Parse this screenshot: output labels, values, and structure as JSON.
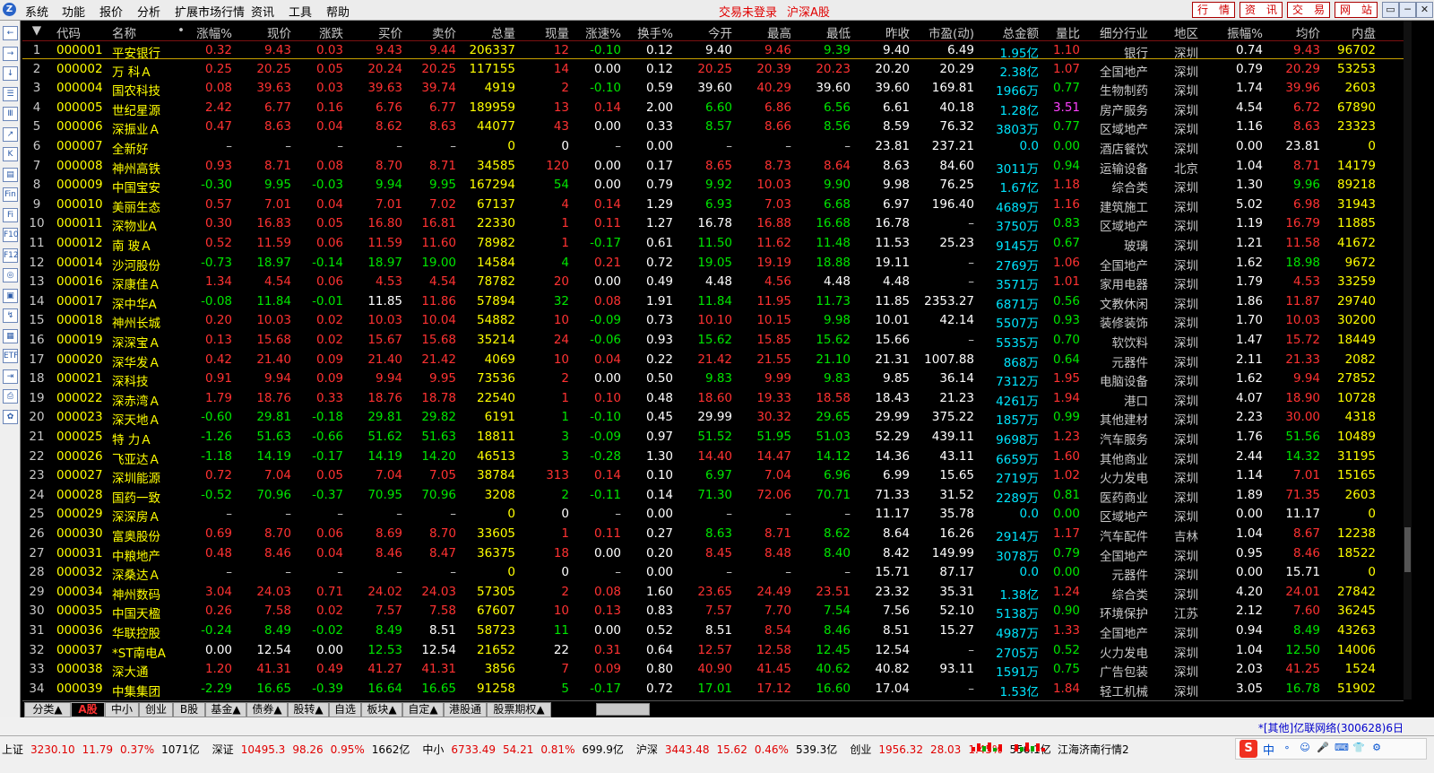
{
  "menubar": {
    "logo": "Z",
    "menus": [
      "系统",
      "功能",
      "报价",
      "分析",
      "扩展市场行情",
      "资讯",
      "工具",
      "帮助"
    ],
    "trade_status": "交易未登录",
    "market_title": "沪深A股",
    "right_buttons": [
      "行　情",
      "资　讯",
      "交　易",
      "网　站"
    ],
    "window_buttons": [
      "▭",
      "─",
      "✕"
    ]
  },
  "left_toolbar": [
    "←",
    "→",
    "↓",
    "☰",
    "Ⅲ",
    "↗",
    "K",
    "▤",
    "Fin",
    "Fi",
    "F10",
    "F12",
    "◎",
    "▣",
    "↯",
    "▦",
    "ETF",
    "⇥",
    "⎙",
    "✿"
  ],
  "table": {
    "headers": [
      "",
      "代码",
      "名称",
      "•",
      "涨幅%",
      "现价",
      "涨跌",
      "买价",
      "卖价",
      "总量",
      "现量",
      "涨速%",
      "换手%",
      "今开",
      "最高",
      "最低",
      "昨收",
      "市盈(动)",
      "总金额",
      "量比",
      "细分行业",
      "地区",
      "振幅%",
      "均价",
      "内盘"
    ],
    "rows": [
      [
        "1",
        "000001",
        "平安银行",
        "0.32",
        "9.43",
        "0.03",
        "9.43",
        "9.44",
        "206337",
        "12",
        "-0.10",
        "0.12",
        "9.40",
        "9.46",
        "9.39",
        "9.40",
        "6.49",
        "1.95亿",
        "1.10",
        "银行",
        "深圳",
        "0.74",
        "9.43",
        "96702"
      ],
      [
        "2",
        "000002",
        "万 科Ａ",
        "0.25",
        "20.25",
        "0.05",
        "20.24",
        "20.25",
        "117155",
        "14",
        "0.00",
        "0.12",
        "20.25",
        "20.39",
        "20.23",
        "20.20",
        "20.29",
        "2.38亿",
        "1.07",
        "全国地产",
        "深圳",
        "0.79",
        "20.29",
        "53253"
      ],
      [
        "3",
        "000004",
        "国农科技",
        "0.08",
        "39.63",
        "0.03",
        "39.63",
        "39.74",
        "4919",
        "2",
        "-0.10",
        "0.59",
        "39.60",
        "40.29",
        "39.60",
        "39.60",
        "169.81",
        "1966万",
        "0.77",
        "生物制药",
        "深圳",
        "1.74",
        "39.96",
        "2603"
      ],
      [
        "4",
        "000005",
        "世纪星源",
        "2.42",
        "6.77",
        "0.16",
        "6.76",
        "6.77",
        "189959",
        "13",
        "0.14",
        "2.00",
        "6.60",
        "6.86",
        "6.56",
        "6.61",
        "40.18",
        "1.28亿",
        "3.51",
        "房产服务",
        "深圳",
        "4.54",
        "6.72",
        "67890"
      ],
      [
        "5",
        "000006",
        "深振业Ａ",
        "0.47",
        "8.63",
        "0.04",
        "8.62",
        "8.63",
        "44077",
        "43",
        "0.00",
        "0.33",
        "8.57",
        "8.66",
        "8.56",
        "8.59",
        "76.32",
        "3803万",
        "0.77",
        "区域地产",
        "深圳",
        "1.16",
        "8.63",
        "23323"
      ],
      [
        "6",
        "000007",
        "全新好",
        "–",
        "–",
        "–",
        "–",
        "–",
        "0",
        "0",
        "–",
        "0.00",
        "–",
        "–",
        "–",
        "23.81",
        "237.21",
        "0.0",
        "0.00",
        "酒店餐饮",
        "深圳",
        "0.00",
        "23.81",
        "0"
      ],
      [
        "7",
        "000008",
        "神州高铁",
        "0.93",
        "8.71",
        "0.08",
        "8.70",
        "8.71",
        "34585",
        "120",
        "0.00",
        "0.17",
        "8.65",
        "8.73",
        "8.64",
        "8.63",
        "84.60",
        "3011万",
        "0.94",
        "运输设备",
        "北京",
        "1.04",
        "8.71",
        "14179"
      ],
      [
        "8",
        "000009",
        "中国宝安",
        "-0.30",
        "9.95",
        "-0.03",
        "9.94",
        "9.95",
        "167294",
        "54",
        "0.00",
        "0.79",
        "9.92",
        "10.03",
        "9.90",
        "9.98",
        "76.25",
        "1.67亿",
        "1.18",
        "综合类",
        "深圳",
        "1.30",
        "9.96",
        "89218"
      ],
      [
        "9",
        "000010",
        "美丽生态",
        "0.57",
        "7.01",
        "0.04",
        "7.01",
        "7.02",
        "67137",
        "4",
        "0.14",
        "1.29",
        "6.93",
        "7.03",
        "6.68",
        "6.97",
        "196.40",
        "4689万",
        "1.16",
        "建筑施工",
        "深圳",
        "5.02",
        "6.98",
        "31943"
      ],
      [
        "10",
        "000011",
        "深物业A",
        "0.30",
        "16.83",
        "0.05",
        "16.80",
        "16.81",
        "22330",
        "1",
        "0.11",
        "1.27",
        "16.78",
        "16.88",
        "16.68",
        "16.78",
        "–",
        "3750万",
        "0.83",
        "区域地产",
        "深圳",
        "1.19",
        "16.79",
        "11885"
      ],
      [
        "11",
        "000012",
        "南 玻Ａ",
        "0.52",
        "11.59",
        "0.06",
        "11.59",
        "11.60",
        "78982",
        "1",
        "-0.17",
        "0.61",
        "11.50",
        "11.62",
        "11.48",
        "11.53",
        "25.23",
        "9145万",
        "0.67",
        "玻璃",
        "深圳",
        "1.21",
        "11.58",
        "41672"
      ],
      [
        "12",
        "000014",
        "沙河股份",
        "-0.73",
        "18.97",
        "-0.14",
        "18.97",
        "19.00",
        "14584",
        "4",
        "0.21",
        "0.72",
        "19.05",
        "19.19",
        "18.88",
        "19.11",
        "–",
        "2769万",
        "1.06",
        "全国地产",
        "深圳",
        "1.62",
        "18.98",
        "9672"
      ],
      [
        "13",
        "000016",
        "深康佳Ａ",
        "1.34",
        "4.54",
        "0.06",
        "4.53",
        "4.54",
        "78782",
        "20",
        "0.00",
        "0.49",
        "4.48",
        "4.56",
        "4.48",
        "4.48",
        "–",
        "3571万",
        "1.01",
        "家用电器",
        "深圳",
        "1.79",
        "4.53",
        "33259"
      ],
      [
        "14",
        "000017",
        "深中华A",
        "-0.08",
        "11.84",
        "-0.01",
        "11.85",
        "11.86",
        "57894",
        "32",
        "0.08",
        "1.91",
        "11.84",
        "11.95",
        "11.73",
        "11.85",
        "2353.27",
        "6871万",
        "0.56",
        "文教休闲",
        "深圳",
        "1.86",
        "11.87",
        "29740"
      ],
      [
        "15",
        "000018",
        "神州长城",
        "0.20",
        "10.03",
        "0.02",
        "10.03",
        "10.04",
        "54882",
        "10",
        "-0.09",
        "0.73",
        "10.10",
        "10.15",
        "9.98",
        "10.01",
        "42.14",
        "5507万",
        "0.93",
        "装修装饰",
        "深圳",
        "1.70",
        "10.03",
        "30200"
      ],
      [
        "16",
        "000019",
        "深深宝Ａ",
        "0.13",
        "15.68",
        "0.02",
        "15.67",
        "15.68",
        "35214",
        "24",
        "-0.06",
        "0.93",
        "15.62",
        "15.85",
        "15.62",
        "15.66",
        "–",
        "5535万",
        "0.70",
        "软饮料",
        "深圳",
        "1.47",
        "15.72",
        "18449"
      ],
      [
        "17",
        "000020",
        "深华发Ａ",
        "0.42",
        "21.40",
        "0.09",
        "21.40",
        "21.42",
        "4069",
        "10",
        "0.04",
        "0.22",
        "21.42",
        "21.55",
        "21.10",
        "21.31",
        "1007.88",
        "868万",
        "0.64",
        "元器件",
        "深圳",
        "2.11",
        "21.33",
        "2082"
      ],
      [
        "18",
        "000021",
        "深科技",
        "0.91",
        "9.94",
        "0.09",
        "9.94",
        "9.95",
        "73536",
        "2",
        "0.00",
        "0.50",
        "9.83",
        "9.99",
        "9.83",
        "9.85",
        "36.14",
        "7312万",
        "1.95",
        "电脑设备",
        "深圳",
        "1.62",
        "9.94",
        "27852"
      ],
      [
        "19",
        "000022",
        "深赤湾Ａ",
        "1.79",
        "18.76",
        "0.33",
        "18.76",
        "18.78",
        "22540",
        "1",
        "0.10",
        "0.48",
        "18.60",
        "19.33",
        "18.58",
        "18.43",
        "21.23",
        "4261万",
        "1.94",
        "港口",
        "深圳",
        "4.07",
        "18.90",
        "10728"
      ],
      [
        "20",
        "000023",
        "深天地Ａ",
        "-0.60",
        "29.81",
        "-0.18",
        "29.81",
        "29.82",
        "6191",
        "1",
        "-0.10",
        "0.45",
        "29.99",
        "30.32",
        "29.65",
        "29.99",
        "375.22",
        "1857万",
        "0.99",
        "其他建材",
        "深圳",
        "2.23",
        "30.00",
        "4318"
      ],
      [
        "21",
        "000025",
        "特 力Ａ",
        "-1.26",
        "51.63",
        "-0.66",
        "51.62",
        "51.63",
        "18811",
        "3",
        "-0.09",
        "0.97",
        "51.52",
        "51.95",
        "51.03",
        "52.29",
        "439.11",
        "9698万",
        "1.23",
        "汽车服务",
        "深圳",
        "1.76",
        "51.56",
        "10489"
      ],
      [
        "22",
        "000026",
        "飞亚达Ａ",
        "-1.18",
        "14.19",
        "-0.17",
        "14.19",
        "14.20",
        "46513",
        "3",
        "-0.28",
        "1.30",
        "14.40",
        "14.47",
        "14.12",
        "14.36",
        "43.11",
        "6659万",
        "1.60",
        "其他商业",
        "深圳",
        "2.44",
        "14.32",
        "31195"
      ],
      [
        "23",
        "000027",
        "深圳能源",
        "0.72",
        "7.04",
        "0.05",
        "7.04",
        "7.05",
        "38784",
        "313",
        "0.14",
        "0.10",
        "6.97",
        "7.04",
        "6.96",
        "6.99",
        "15.65",
        "2719万",
        "1.02",
        "火力发电",
        "深圳",
        "1.14",
        "7.01",
        "15165"
      ],
      [
        "24",
        "000028",
        "国药一致",
        "-0.52",
        "70.96",
        "-0.37",
        "70.95",
        "70.96",
        "3208",
        "2",
        "-0.11",
        "0.14",
        "71.30",
        "72.06",
        "70.71",
        "71.33",
        "31.52",
        "2289万",
        "0.81",
        "医药商业",
        "深圳",
        "1.89",
        "71.35",
        "2603"
      ],
      [
        "25",
        "000029",
        "深深房Ａ",
        "–",
        "–",
        "–",
        "–",
        "–",
        "0",
        "0",
        "–",
        "0.00",
        "–",
        "–",
        "–",
        "11.17",
        "35.78",
        "0.0",
        "0.00",
        "区域地产",
        "深圳",
        "0.00",
        "11.17",
        "0"
      ],
      [
        "26",
        "000030",
        "富奥股份",
        "0.69",
        "8.70",
        "0.06",
        "8.69",
        "8.70",
        "33605",
        "1",
        "0.11",
        "0.27",
        "8.63",
        "8.71",
        "8.62",
        "8.64",
        "16.26",
        "2914万",
        "1.17",
        "汽车配件",
        "吉林",
        "1.04",
        "8.67",
        "12238"
      ],
      [
        "27",
        "000031",
        "中粮地产",
        "0.48",
        "8.46",
        "0.04",
        "8.46",
        "8.47",
        "36375",
        "18",
        "0.00",
        "0.20",
        "8.45",
        "8.48",
        "8.40",
        "8.42",
        "149.99",
        "3078万",
        "0.79",
        "全国地产",
        "深圳",
        "0.95",
        "8.46",
        "18522"
      ],
      [
        "28",
        "000032",
        "深桑达Ａ",
        "–",
        "–",
        "–",
        "–",
        "–",
        "0",
        "0",
        "–",
        "0.00",
        "–",
        "–",
        "–",
        "15.71",
        "87.17",
        "0.0",
        "0.00",
        "元器件",
        "深圳",
        "0.00",
        "15.71",
        "0"
      ],
      [
        "29",
        "000034",
        "神州数码",
        "3.04",
        "24.03",
        "0.71",
        "24.02",
        "24.03",
        "57305",
        "2",
        "0.08",
        "1.60",
        "23.65",
        "24.49",
        "23.51",
        "23.32",
        "35.31",
        "1.38亿",
        "1.24",
        "综合类",
        "深圳",
        "4.20",
        "24.01",
        "27842"
      ],
      [
        "30",
        "000035",
        "中国天楹",
        "0.26",
        "7.58",
        "0.02",
        "7.57",
        "7.58",
        "67607",
        "10",
        "0.13",
        "0.83",
        "7.57",
        "7.70",
        "7.54",
        "7.56",
        "52.10",
        "5138万",
        "0.90",
        "环境保护",
        "江苏",
        "2.12",
        "7.60",
        "36245"
      ],
      [
        "31",
        "000036",
        "华联控股",
        "-0.24",
        "8.49",
        "-0.02",
        "8.49",
        "8.51",
        "58723",
        "11",
        "0.00",
        "0.52",
        "8.51",
        "8.54",
        "8.46",
        "8.51",
        "15.27",
        "4987万",
        "1.33",
        "全国地产",
        "深圳",
        "0.94",
        "8.49",
        "43263"
      ],
      [
        "32",
        "000037",
        "*ST南电A",
        "0.00",
        "12.54",
        "0.00",
        "12.53",
        "12.54",
        "21652",
        "22",
        "0.31",
        "0.64",
        "12.57",
        "12.58",
        "12.45",
        "12.54",
        "–",
        "2705万",
        "0.52",
        "火力发电",
        "深圳",
        "1.04",
        "12.50",
        "14006"
      ],
      [
        "33",
        "000038",
        "深大通",
        "1.20",
        "41.31",
        "0.49",
        "41.27",
        "41.31",
        "3856",
        "7",
        "0.09",
        "0.80",
        "40.90",
        "41.45",
        "40.62",
        "40.82",
        "93.11",
        "1591万",
        "0.75",
        "广告包装",
        "深圳",
        "2.03",
        "41.25",
        "1524"
      ],
      [
        "34",
        "000039",
        "中集集团",
        "-2.29",
        "16.65",
        "-0.39",
        "16.64",
        "16.65",
        "91258",
        "5",
        "-0.17",
        "0.72",
        "17.01",
        "17.12",
        "16.60",
        "17.04",
        "–",
        "1.53亿",
        "1.84",
        "轻工机械",
        "深圳",
        "3.05",
        "16.78",
        "51902"
      ]
    ]
  },
  "colors": {
    "up": "#ff3232",
    "down": "#00e600",
    "flat": "#ffffff",
    "amount": "#00e6ff",
    "code": "#ffff00",
    "name": "#ffff00",
    "text": "#c8c8c8"
  },
  "tabs": [
    "分类▲",
    "A股",
    "中小",
    "创业",
    "B股",
    "基金▲",
    "债券▲",
    "股转▲",
    "自选",
    "板块▲",
    "自定▲",
    "港股通",
    "股票期权▲"
  ],
  "active_tab": 1,
  "broker_text": "*[其他]亿联网络(300628)6日",
  "status_bar": [
    {
      "name": "上证",
      "value": "3230.10",
      "change": "11.79",
      "pct": "0.37%",
      "amount": "1071亿"
    },
    {
      "name": "深证",
      "value": "10495.3",
      "change": "98.26",
      "pct": "0.95%",
      "amount": "1662亿"
    },
    {
      "name": "中小",
      "value": "6733.49",
      "change": "54.21",
      "pct": "0.81%",
      "amount": "699.9亿"
    },
    {
      "name": "沪深",
      "value": "3443.48",
      "change": "15.62",
      "pct": "0.46%",
      "amount": "539.3亿"
    },
    {
      "name": "创业",
      "value": "1956.32",
      "change": "28.03",
      "pct": "1.45%",
      "amount": "556.1亿"
    }
  ],
  "server": "江海济南行情2",
  "ime": {
    "logo": "S",
    "mode": "中",
    "icons": [
      "∘",
      "☺",
      "🎤",
      "⌨",
      "👕",
      "⚙"
    ]
  }
}
